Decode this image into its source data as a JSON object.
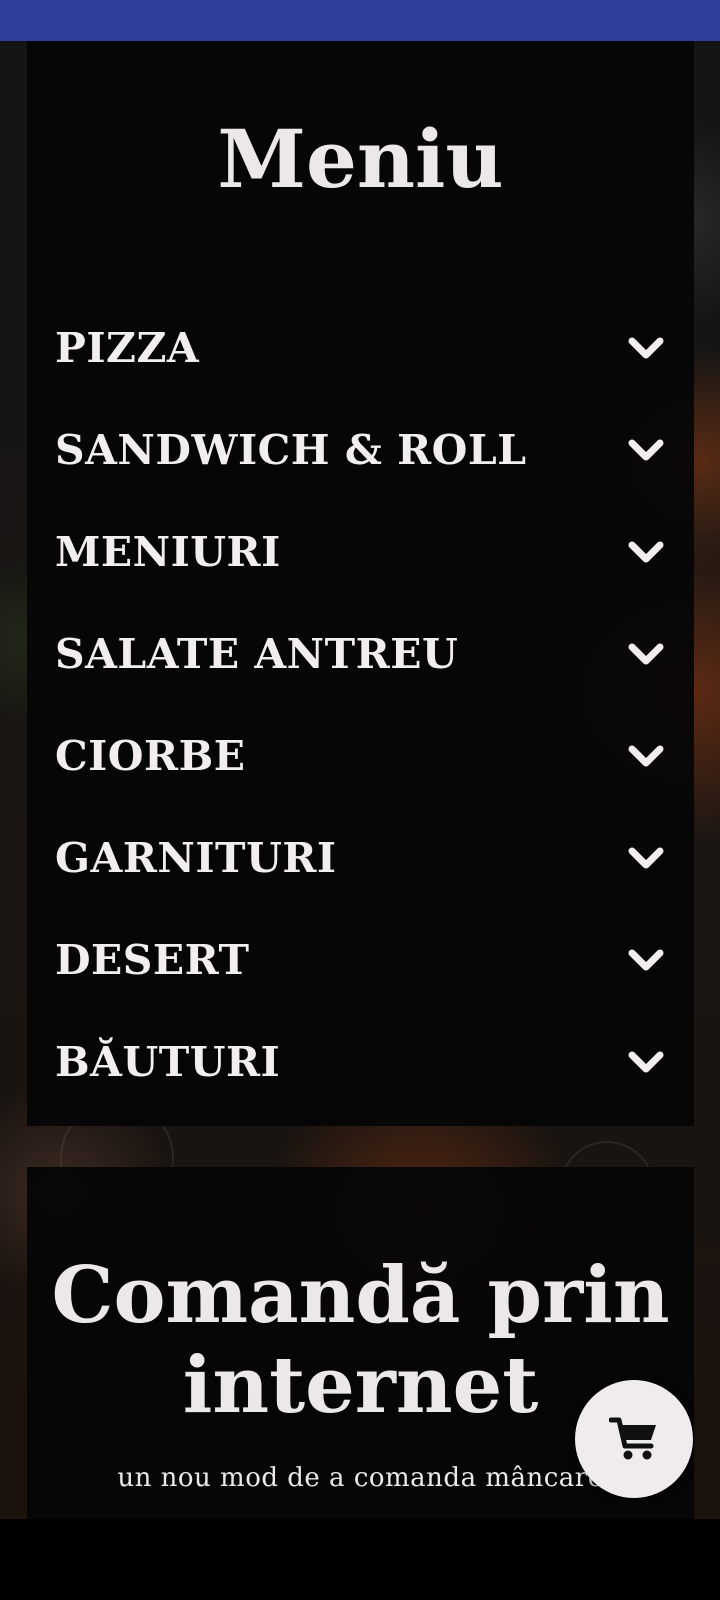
{
  "colors": {
    "status_bar": "#2f3f9b",
    "panel_bg": "#050506",
    "text": "#f2eef0",
    "fab_bg": "#efebee"
  },
  "menu": {
    "title": "Meniu",
    "categories": [
      {
        "label": "PIZZA",
        "icon": "chevron-down-icon"
      },
      {
        "label": "SANDWICH & ROLL",
        "icon": "chevron-down-icon"
      },
      {
        "label": "MENIURI",
        "icon": "chevron-down-icon"
      },
      {
        "label": "SALATE ANTREU",
        "icon": "chevron-down-icon"
      },
      {
        "label": "CIORBE",
        "icon": "chevron-down-icon"
      },
      {
        "label": "GARNITURI",
        "icon": "chevron-down-icon"
      },
      {
        "label": "DESERT",
        "icon": "chevron-down-icon"
      },
      {
        "label": "BĂUTURI",
        "icon": "chevron-down-icon"
      }
    ]
  },
  "order": {
    "title_line1": "Comandă prin",
    "title_line2": "internet",
    "subtitle": "un nou mod de a comanda mâncare"
  },
  "cart": {
    "icon": "shopping-cart-icon"
  }
}
